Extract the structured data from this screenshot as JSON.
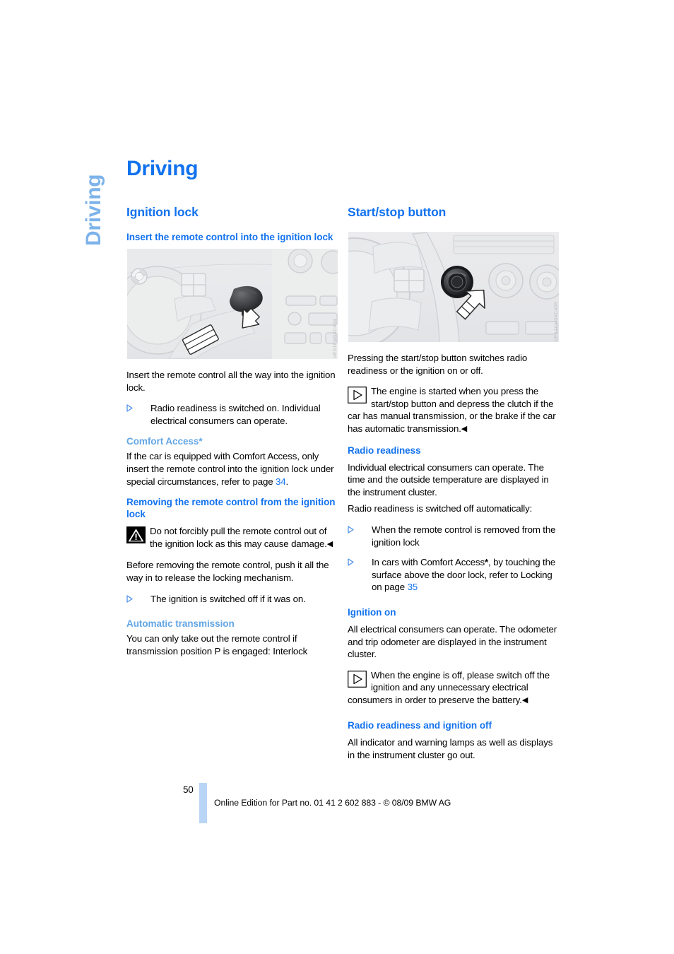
{
  "chapter_tab": "Driving",
  "page_title": "Driving",
  "colors": {
    "heading_blue": "#1272ee",
    "light_blue": "#63a6e4",
    "tab_blue": "#7db3ea",
    "footer_bar": "#b9d5f5"
  },
  "left_column": {
    "section_heading": "Ignition lock",
    "sub_heading_1": "Insert the remote control into the ignition lock",
    "figure": {
      "name": "ignition-lock-illustration",
      "code": "VES1CM0ACA04"
    },
    "paragraph_1": "Insert the remote control all the way into the ignition lock.",
    "bullet_1": "Radio readiness is switched on. Individual electrical consumers can operate.",
    "sub_heading_2": "Comfort Access",
    "sub_heading_2_star": "*",
    "paragraph_2_pre": "If the car is equipped with Comfort Access, only insert the remote control into the ignition lock under special circumstances, refer to page ",
    "paragraph_2_ref": "34",
    "paragraph_2_post": ".",
    "sub_heading_3": "Removing the remote control from the ignition lock",
    "warning_text": "Do not forcibly pull the remote control out of the ignition lock as this may cause damage.",
    "warning_endmark": "◀",
    "paragraph_3": "Before removing the remote control, push it all the way in to release the locking mechanism.",
    "bullet_2": "The ignition is switched off if it was on.",
    "sub_heading_4": "Automatic transmission",
    "paragraph_4": "You can only take out the remote control if transmission position P is engaged: Interlock"
  },
  "right_column": {
    "section_heading": "Start/stop button",
    "figure": {
      "name": "start-stop-button-illustration",
      "code": "VES1CM0ACA05"
    },
    "paragraph_1": "Pressing the start/stop button switches radio readiness or the ignition on or off.",
    "note_1_text": "The engine is started when you press the start/stop button and depress the clutch if the car has manual transmission, or the brake if the car has automatic transmission.",
    "note_1_endmark": "◀",
    "sub_heading_1": "Radio readiness",
    "paragraph_2": "Individual electrical consumers can operate. The time and the outside temperature are displayed in the instrument cluster.",
    "paragraph_3": "Radio readiness is switched off automatically:",
    "bullet_1": "When the remote control is removed from the ignition lock",
    "bullet_2_pre": "In cars with Comfort Access",
    "bullet_2_star": "*",
    "bullet_2_mid": ", by touching the surface above the door lock, refer to Locking on page ",
    "bullet_2_ref": "35",
    "sub_heading_2": "Ignition on",
    "paragraph_4": "All electrical consumers can operate. The odometer and trip odometer are displayed in the instrument cluster.",
    "note_2_text": "When the engine is off, please switch off the ignition and any unnecessary electrical consumers in order to preserve the battery.",
    "note_2_endmark": "◀",
    "sub_heading_3": "Radio readiness and ignition off",
    "paragraph_5": "All indicator and warning lamps as well as displays in the instrument cluster go out."
  },
  "footer": {
    "page_number": "50",
    "note": "Online Edition for Part no. 01 41 2 602 883 - © 08/09 BMW AG"
  }
}
